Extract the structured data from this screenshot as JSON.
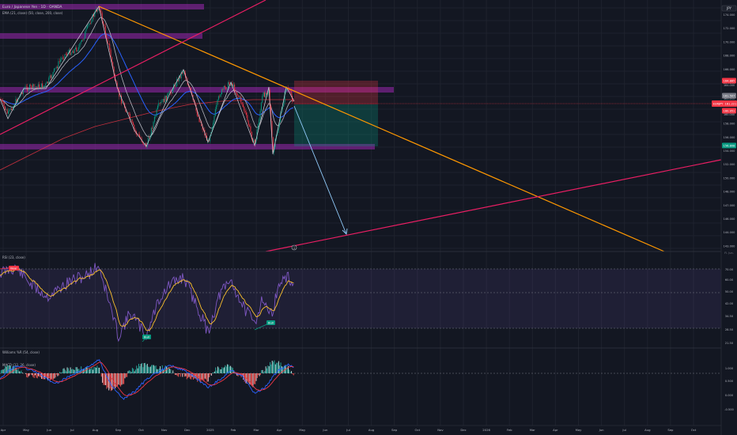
{
  "header": {
    "symbol_title": "Euro / Japanese Yen · 1D · OANDA",
    "ema_label": "EMA (21, close) (50, close, 200, close)"
  },
  "currency": "JPY",
  "price_axis": [
    "174.000",
    "172.000",
    "170.000",
    "168.000",
    "166.000",
    "164.000",
    "162.000",
    "160.000",
    "158.000",
    "156.000",
    "154.000",
    "152.000",
    "150.000",
    "148.000",
    "147.000",
    "146.000",
    "144.000",
    "143.000"
  ],
  "price_tags": [
    {
      "text": "164.885",
      "color": "#f23645"
    },
    {
      "text": "161.507",
      "color": "#787b86"
    },
    {
      "text": "160.951",
      "color": "#f23645"
    },
    {
      "text": "156.808",
      "color": "#089981"
    }
  ],
  "price_tags_small": [
    "164.000",
    "161.211",
    "160.000"
  ],
  "price_axis_bottom": "Fl. Jun.",
  "current_price": {
    "symbol": "EURJPY",
    "value": "161.221",
    "color": "#f23645"
  },
  "rsi": {
    "label": "RSI (23, close)",
    "axis": [
      "70.00",
      "60.00",
      "50.00",
      "42.00",
      "34.50",
      "28.50",
      "21.50"
    ],
    "badges": [
      {
        "text": "Bear",
        "color": "#f23645"
      },
      {
        "text": "Bull",
        "color": "#089981"
      },
      {
        "text": "Bull",
        "color": "#089981"
      }
    ]
  },
  "williams": {
    "label": "Williams %R (54, close)"
  },
  "macd": {
    "label": "MACD (12, 26, close)",
    "axis": [
      "1.000",
      "0.500",
      "0.000",
      "-0.500"
    ]
  },
  "time_axis": [
    "Apr",
    "May",
    "Jun",
    "Jul",
    "Aug",
    "Sep",
    "Oct",
    "Nov",
    "Dec",
    "2025",
    "Feb",
    "Mar",
    "Apr",
    "May",
    "Jun",
    "Jul",
    "Aug",
    "Sep",
    "Oct",
    "Nov",
    "Dec",
    "2026",
    "Feb",
    "Mar",
    "Apr",
    "May",
    "Jun",
    "Jul",
    "Aug",
    "Sep",
    "Oct"
  ],
  "colors": {
    "background": "#131722",
    "zones": "#9c27b0",
    "trendline_orange": "#ff9800",
    "trendline_pink": "#e91e63",
    "ema_blue": "#2962ff",
    "ema_red": "#f23645",
    "ema_fast": "#b2b5be",
    "candle_up": "#089981",
    "candle_down": "#f23645",
    "rsi_line": "#7e57c2",
    "rsi_ma": "#fbc02d"
  },
  "marker_label": "1"
}
